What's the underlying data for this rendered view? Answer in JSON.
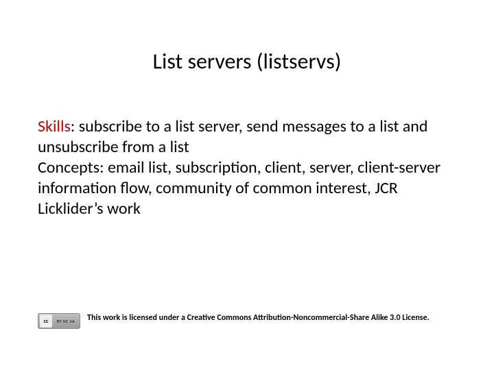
{
  "title": "List servers (listservs)",
  "body": {
    "skills_label": "Skills",
    "skills_text": ": subscribe to a list server, send messages to a list and unsubscribe from a list",
    "concepts_label": "Concepts",
    "concepts_text": ": email list, subscription, client, server, client-server information flow, community of common interest, JCR Licklider’s work"
  },
  "footer": {
    "cc_main": "cc",
    "cc_sub": "BY  NC  SA",
    "license_text": "This work is licensed under a Creative Commons Attribution-Noncommercial-Share Alike 3.0 License."
  }
}
